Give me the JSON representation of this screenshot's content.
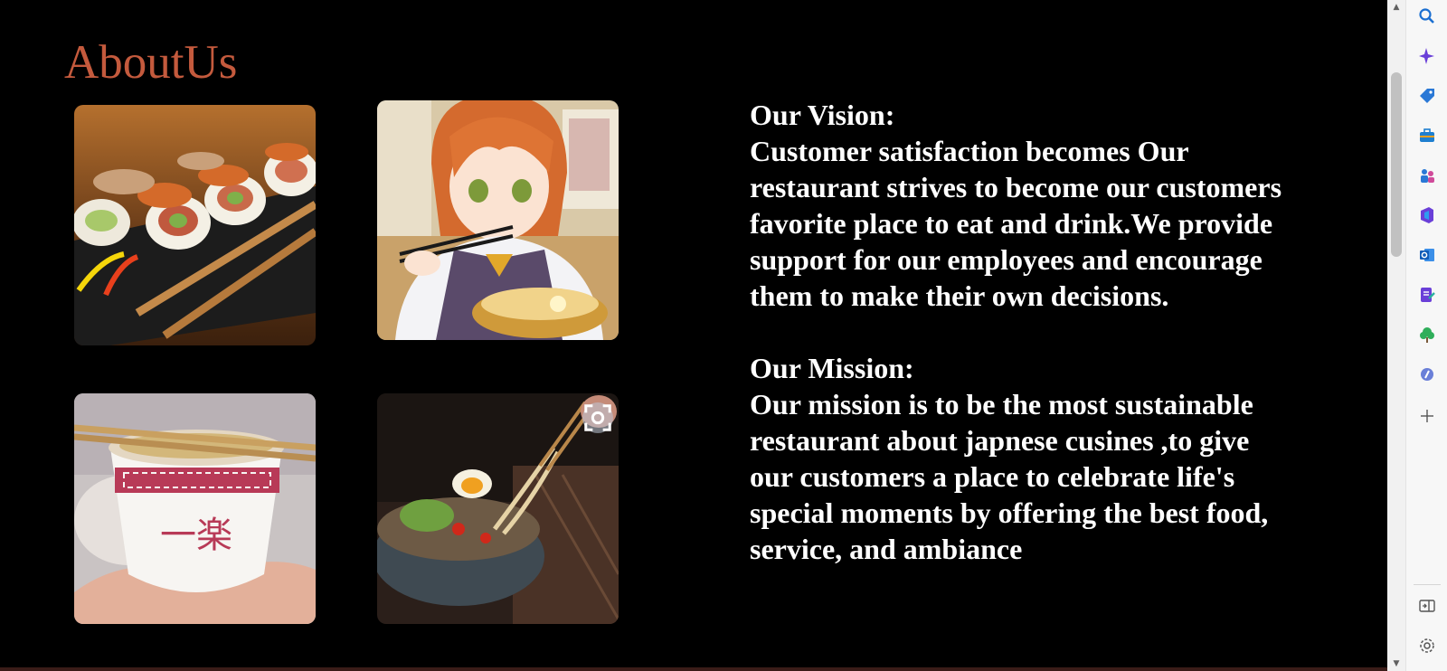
{
  "section": {
    "title": "AboutUs"
  },
  "images": [
    {
      "alt": "sushi rolls with chopsticks"
    },
    {
      "alt": "anime girl eating ramen"
    },
    {
      "alt": "ramen bowl held in hand"
    },
    {
      "alt": "ramen bowl with chopsticks lifting noodles"
    }
  ],
  "vision": {
    "heading": "Our Vision:",
    "body": "Customer satisfaction becomes Our restaurant strives to become our customers favorite place to eat and drink.We provide support for our employees and encourage them to make their own decisions."
  },
  "mission": {
    "heading": "Our Mission:",
    "body": "Our mission is to be the most sustainable restaurant about japnese cusines ,to give our customers a place to celebrate life's special moments by offering the best food, service, and ambiance"
  },
  "bowl_text": "一楽",
  "sidebar": {
    "icons": [
      "search-icon",
      "copilot-icon",
      "shopping-tag-icon",
      "toolbox-icon",
      "games-icon",
      "office-icon",
      "outlook-icon",
      "drop-icon",
      "tree-icon",
      "discover-icon",
      "add-icon",
      "split-screen-icon",
      "settings-icon"
    ]
  },
  "colors": {
    "title": "#c45a3d",
    "background": "#000000",
    "text": "#ffffff"
  }
}
